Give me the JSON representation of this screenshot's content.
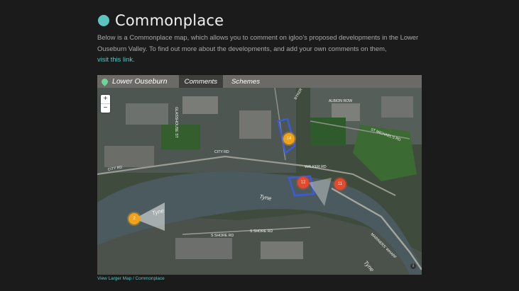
{
  "header": {
    "title": "Commonplace"
  },
  "intro": {
    "text": "Below is a Commonplace map, which allows you to comment on igloo’s proposed developments in the Lower Ouseburn Valley. To find out more about the developments, and add your own comments on them,",
    "link": "visit this link",
    "end": "."
  },
  "map": {
    "title": "Lower Ouseburn",
    "tabs": [
      {
        "label": "Comments"
      },
      {
        "label": "Schemes"
      }
    ],
    "zoom": {
      "in": "+",
      "out": "−"
    },
    "clusters": [
      {
        "count": "14"
      },
      {
        "count": "12"
      },
      {
        "count": "11"
      },
      {
        "count": "2"
      }
    ],
    "labels": {
      "albion_row": "ALBION ROW",
      "st_michaels": "ST MICHAEL'S RD",
      "city_rd": "CITY RD",
      "city_rd2": "CITY RD",
      "walker_rd": "WALKER RD",
      "s_shore": "S SHORE RD",
      "shore_rd": "S SHORE RD",
      "mariners": "MARINERS' WHARF",
      "byker_bank": "BYKER BANK",
      "glasshouse": "GLASSHOUSE ST",
      "tyne_main": "Tyne",
      "tyne_west": "Tyne",
      "tyne_east": "Tyne"
    },
    "colors": {
      "cluster_orange": "#f0a21a",
      "cluster_red": "#e74a2a",
      "scheme_outline": "#3c5bd6",
      "river": "#4a5a5e"
    },
    "info_icon": "i"
  },
  "footer": {
    "link": "View Larger Map / Commonplace"
  }
}
